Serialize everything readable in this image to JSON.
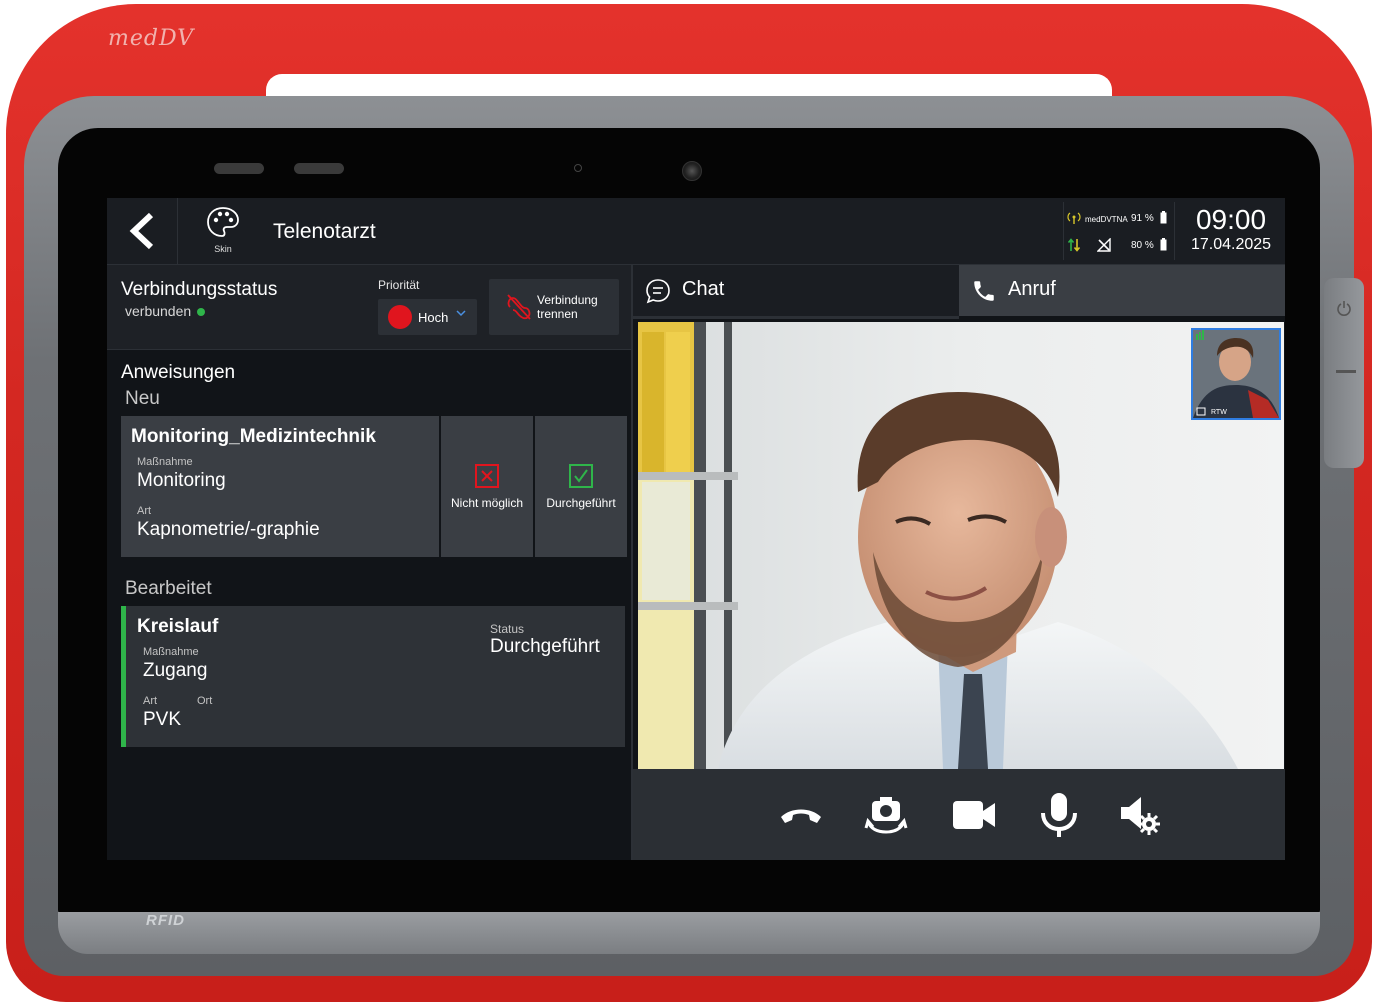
{
  "device": {
    "brand": "medDV",
    "rfid_label": "RFID"
  },
  "topbar": {
    "skin_label": "Skin",
    "title": "Telenotarzt",
    "network_name": "medDVTNA",
    "signal_percent": "91 %",
    "battery_percent": "80 %",
    "time": "09:00",
    "date": "17.04.2025"
  },
  "connection": {
    "title": "Verbindungsstatus",
    "status": "verbunden",
    "priority_label": "Priorität",
    "priority_value": "Hoch",
    "disconnect_label_1": "Verbindung",
    "disconnect_label_2": "trennen"
  },
  "instructions": {
    "title": "Anweisungen",
    "new_section": "Neu",
    "new_card": {
      "title": "Monitoring_Medizintechnik",
      "measure_label": "Maßnahme",
      "measure_value": "Monitoring",
      "type_label": "Art",
      "type_value": "Kapnometrie/-graphie"
    },
    "not_possible_label": "Nicht möglich",
    "done_label": "Durchgeführt",
    "edited_section": "Bearbeitet",
    "edited_card": {
      "title": "Kreislauf",
      "measure_label": "Maßnahme",
      "measure_value": "Zugang",
      "type_label": "Art",
      "location_label": "Ort",
      "type_value": "PVK",
      "status_label": "Status",
      "status_value": "Durchgeführt"
    }
  },
  "tabs": {
    "chat": "Chat",
    "call": "Anruf"
  },
  "video": {
    "pip_label": "RTW"
  },
  "colors": {
    "accent_red": "#e0151e",
    "accent_green": "#2fb54a",
    "accent_blue": "#2f7de1",
    "shell_red": "#d42822"
  },
  "icons": [
    "back-chevron-icon",
    "skin-palette-icon",
    "antenna-icon",
    "transfer-arrows-icon",
    "no-signal-icon",
    "battery-icon",
    "disconnect-icon",
    "x-box-icon",
    "check-box-icon",
    "chat-bubble-icon",
    "phone-icon",
    "hangup-icon",
    "camera-switch-icon",
    "video-camera-icon",
    "microphone-icon",
    "speaker-settings-icon"
  ]
}
